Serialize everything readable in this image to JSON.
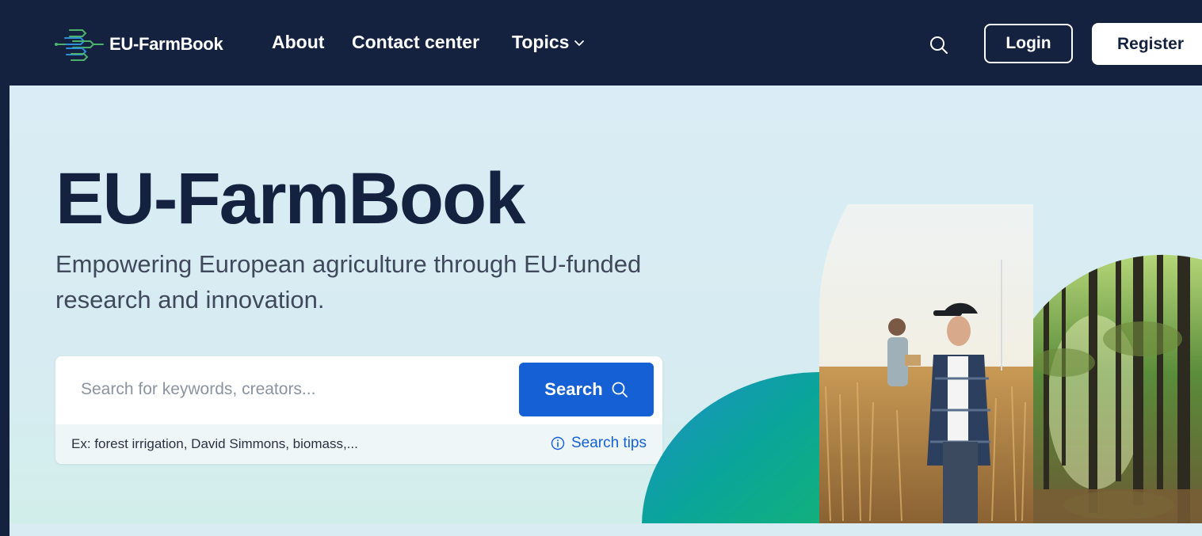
{
  "navbar": {
    "brand_name": "EU-FarmBook",
    "links": [
      {
        "label": "About"
      },
      {
        "label": "Contact center"
      },
      {
        "label": "Topics"
      }
    ],
    "login_label": "Login",
    "register_label": "Register"
  },
  "hero": {
    "title": "EU-FarmBook",
    "subtitle": "Empowering European agriculture through EU-funded research and innovation."
  },
  "search": {
    "placeholder": "Search for keywords, creators...",
    "value": "",
    "button_label": "Search",
    "example": "Ex: forest irrigation, David Simmons, biomass,...",
    "tips_label": "Search tips"
  },
  "colors": {
    "navy": "#14223f",
    "accent_blue": "#1560d4",
    "hero_bg": "#d9ecf4",
    "teal": "#0aa094"
  },
  "icons": [
    "farmbook-logo-icon",
    "chevron-down-icon",
    "search-icon",
    "info-icon"
  ]
}
